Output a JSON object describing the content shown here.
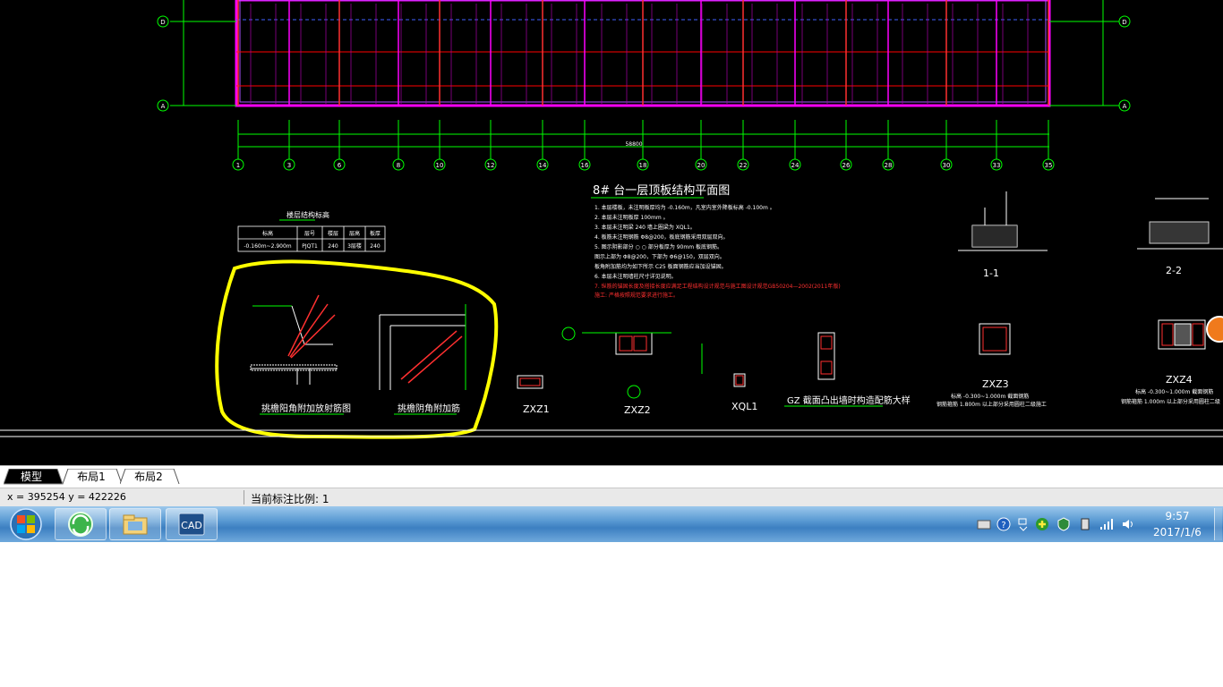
{
  "drawing": {
    "plan_title": "8# 台一层顶板结构平面图",
    "overall_dimension": "58800",
    "axis_numbers": [
      "1",
      "3",
      "6",
      "8",
      "10",
      "12",
      "14",
      "16",
      "18",
      "20",
      "22",
      "24",
      "26",
      "28",
      "30",
      "33",
      "35"
    ],
    "row_axis_left": [
      "D",
      "A"
    ],
    "row_axis_right": [
      "D",
      "A"
    ],
    "notes": [
      "1. 本层楼板，未注明板厚均为         -0.160m，凡室内室外降板标高            -0.100m 。",
      "2. 本层未注明板厚          100mm 。",
      "3. 本层未注明梁         240 墙上圈梁为    XQL1。",
      "4. 板筋未注明钢筋       Φ8@200，板底钢筋采用双层双向。",
      "5. 图示阴影部分           ○ ○ 部分板厚为    90mm    板底钢筋。",
      "   图示上部为      Φ8@200，下部为    Φ6@150，双层双向。",
      "   板角附加筋均为如下所示       C25 板面钢筋应当加设锚固。",
      "6. 本层未注明墙柱尺寸详见说明。"
    ],
    "red_notes": [
      "7. 纵筋的锚固长度及搭接长度应满足工程结构设计规范与施工图设计规范GB50204—2002(2011年版)",
      "   施工: 严格按照规范要求进行施工。"
    ],
    "table": {
      "title": "楼层结构标高",
      "headers": [
        "标高",
        "层号",
        "楼层",
        "层高",
        "板厚"
      ],
      "row": [
        "-0.160m~2.900m",
        "PJQT1",
        "240",
        "3层楼",
        "240"
      ]
    },
    "detail_labels": {
      "corner_rebar": "挑檐阳角附加放射筋图",
      "corner_reinforce": "挑檐阴角附加筋",
      "section_1": "1-1",
      "section_2": "2-2",
      "zxz1": "ZXZ1",
      "zxz2": "ZXZ2",
      "xql1": "XQL1",
      "gz": "GZ  截面凸出墙时构造配筋大样",
      "zxz3": "ZXZ3",
      "zxz4": "ZXZ4",
      "zxz3_note1": "标高 -0.300~1.000m    截面钢筋",
      "zxz3_note2": "钢筋箍筋 1.800m  以上部分采用圆柱二级施工",
      "zxz4_note1": "标高 -0.300~1.000m    截面钢筋",
      "zxz4_note2": "钢筋箍筋  1.000m  以上部分采用圆柱二级"
    }
  },
  "tabs": [
    "模型",
    "布局1",
    "布局2"
  ],
  "status": {
    "coords": "x = 395254  y = 422226",
    "scale": "当前标注比例: 1"
  },
  "taskbar": {
    "apps": [
      "start-orb-icon",
      "browser-icon",
      "file-explorer-icon",
      "cad-app-icon"
    ],
    "cad_label": "CAD",
    "clock_time": "9:57",
    "clock_date": "2017/1/6"
  },
  "colors": {
    "canvas_bg": "#000000",
    "dim_green": "#00ff00",
    "wall_magenta": "#ff00ff",
    "beam_red": "#ff0000",
    "highlight_yellow": "#ffff00",
    "taskbar_blue": "#3c7fc1"
  }
}
